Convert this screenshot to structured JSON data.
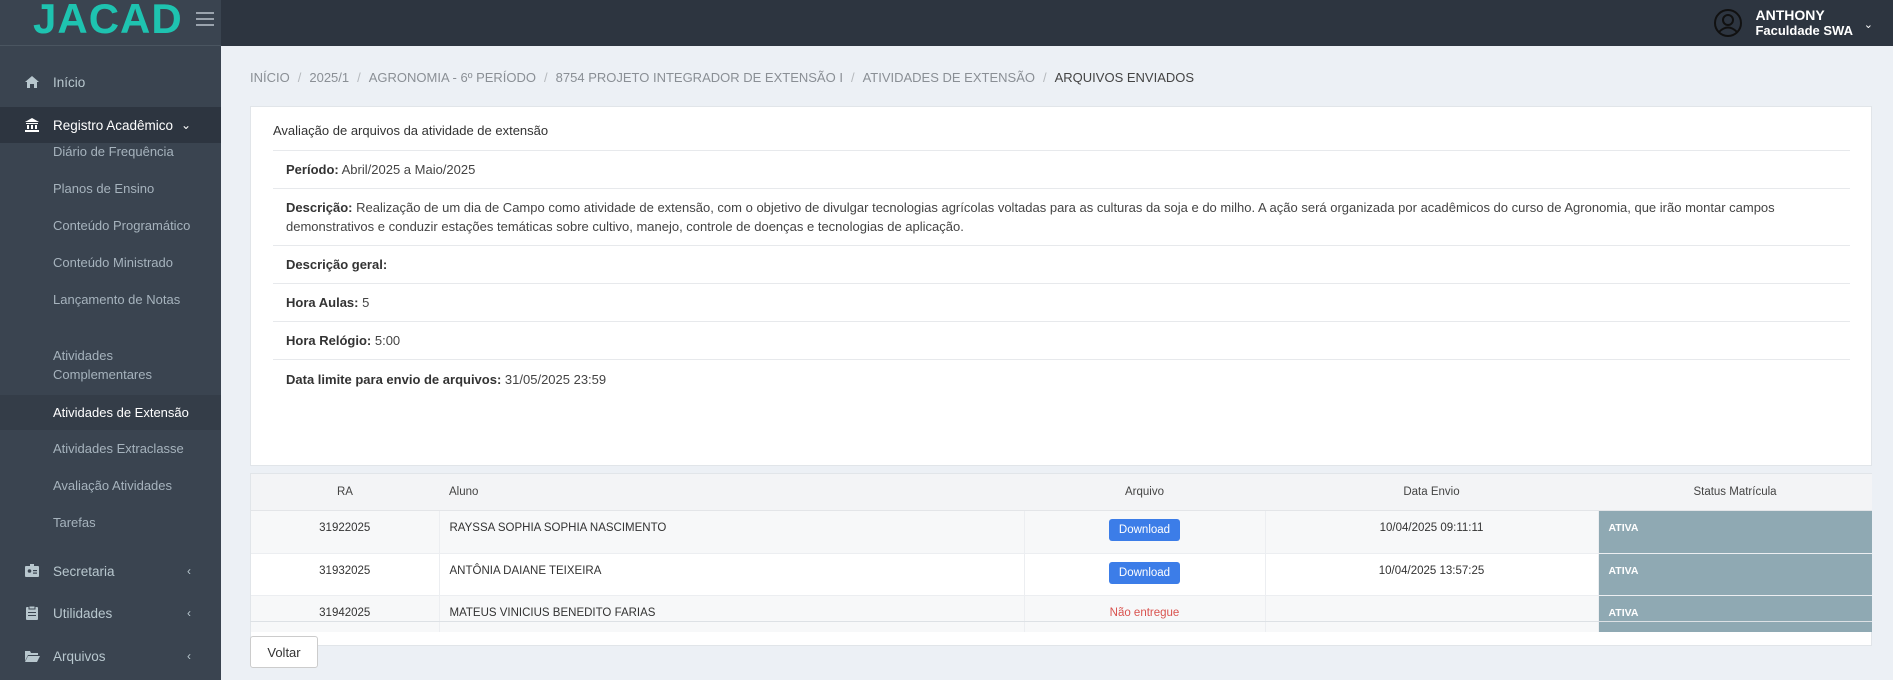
{
  "app": {
    "logo_text": "JACAD"
  },
  "user": {
    "name": "ANTHONY",
    "org": "Faculdade SWA"
  },
  "sidebar": {
    "items": [
      {
        "label": "Início",
        "icon": "home-icon"
      },
      {
        "label": "Registro Acadêmico",
        "icon": "bank-icon",
        "expanded": true
      },
      {
        "label": "Secretaria",
        "icon": "id-card-icon"
      },
      {
        "label": "Utilidades",
        "icon": "clipboard-icon"
      },
      {
        "label": "Arquivos",
        "icon": "folder-open-icon"
      }
    ],
    "sub_items": [
      {
        "label": "Diário de Frequência"
      },
      {
        "label": "Planos de Ensino"
      },
      {
        "label": "Conteúdo Programático"
      },
      {
        "label": "Conteúdo Ministrado"
      },
      {
        "label": "Lançamento de Notas"
      },
      {
        "label": "Atividades Complementares"
      },
      {
        "label": "Atividades de Extensão",
        "active": true
      },
      {
        "label": "Atividades Extraclasse"
      },
      {
        "label": "Avaliação Atividades"
      },
      {
        "label": "Tarefas"
      }
    ]
  },
  "breadcrumb": [
    "INÍCIO",
    "2025/1",
    "AGRONOMIA - 6º PERÍODO",
    "8754 PROJETO INTEGRADOR DE EXTENSÃO I",
    "ATIVIDADES DE EXTENSÃO",
    "ARQUIVOS ENVIADOS"
  ],
  "panel": {
    "title": "Avaliação de arquivos da atividade de extensão",
    "periodo_label": "Período:",
    "periodo_value": "Abril/2025 a Maio/2025",
    "descricao_label": "Descrição:",
    "descricao_value": "Realização de um dia de Campo como atividade de extensão, com o objetivo de divulgar tecnologias agrícolas voltadas para as culturas da soja e do milho. A ação será organizada por acadêmicos do curso de Agronomia, que irão montar campos demonstrativos e conduzir estações temáticas sobre cultivo, manejo, controle de doenças e tecnologias de aplicação.",
    "descricao_geral_label": "Descrição geral:",
    "hora_aulas_label": "Hora Aulas:",
    "hora_aulas_value": "5",
    "hora_relogio_label": "Hora Relógio:",
    "hora_relogio_value": "5:00",
    "data_limite_label": "Data limite para envio de arquivos:",
    "data_limite_value": "31/05/2025 23:59"
  },
  "table": {
    "headers": {
      "ra": "RA",
      "aluno": "Aluno",
      "arquivo": "Arquivo",
      "data_envio": "Data Envio",
      "status": "Status Matrícula"
    },
    "rows": [
      {
        "ra": "31922025",
        "aluno": "RAYSSA SOPHIA SOPHIA NASCIMENTO",
        "arquivo": "Download",
        "data_envio": "10/04/2025 09:11:11",
        "status": "ATIVA"
      },
      {
        "ra": "31932025",
        "aluno": "ANTÔNIA DAIANE TEIXEIRA",
        "arquivo": "Download",
        "data_envio": "10/04/2025 13:57:25",
        "status": "ATIVA"
      },
      {
        "ra": "31942025",
        "aluno": "MATEUS VINICIUS BENEDITO FARIAS",
        "arquivo": "Não entregue",
        "data_envio": "",
        "status": "ATIVA"
      }
    ]
  },
  "actions": {
    "back_label": "Voltar"
  },
  "colors": {
    "topbar": "#2d3540",
    "sidebar": "#3a4450",
    "accent": "#1ec3b0",
    "download": "#3c7de8",
    "status": "#8fa9b3",
    "danger": "#d9534f"
  }
}
